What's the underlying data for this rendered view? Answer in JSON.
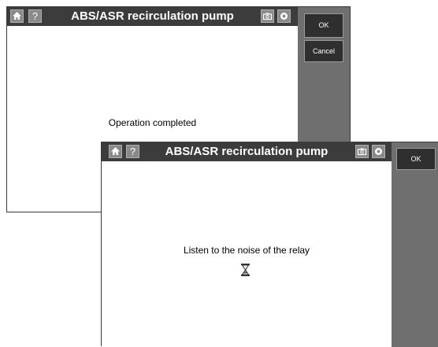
{
  "back_dialog": {
    "title": "ABS/ASR recirculation pump",
    "help_label": "?",
    "message": "Operation completed",
    "ok_label": "OK",
    "cancel_label": "Cancel",
    "icons": [
      "home-icon",
      "help-icon",
      "camera-icon",
      "record-icon"
    ]
  },
  "front_dialog": {
    "title": "ABS/ASR recirculation pump",
    "help_label": "?",
    "message": "Listen to the noise of the relay",
    "ok_label": "OK",
    "status_icon": "hourglass-icon",
    "icons": [
      "home-icon",
      "help-icon",
      "camera-icon",
      "record-icon"
    ]
  },
  "colors": {
    "titlebar": "#3c3c3c",
    "side_panel": "#6f6f6f",
    "button": "#2f2f2f",
    "content": "#ffffff"
  }
}
